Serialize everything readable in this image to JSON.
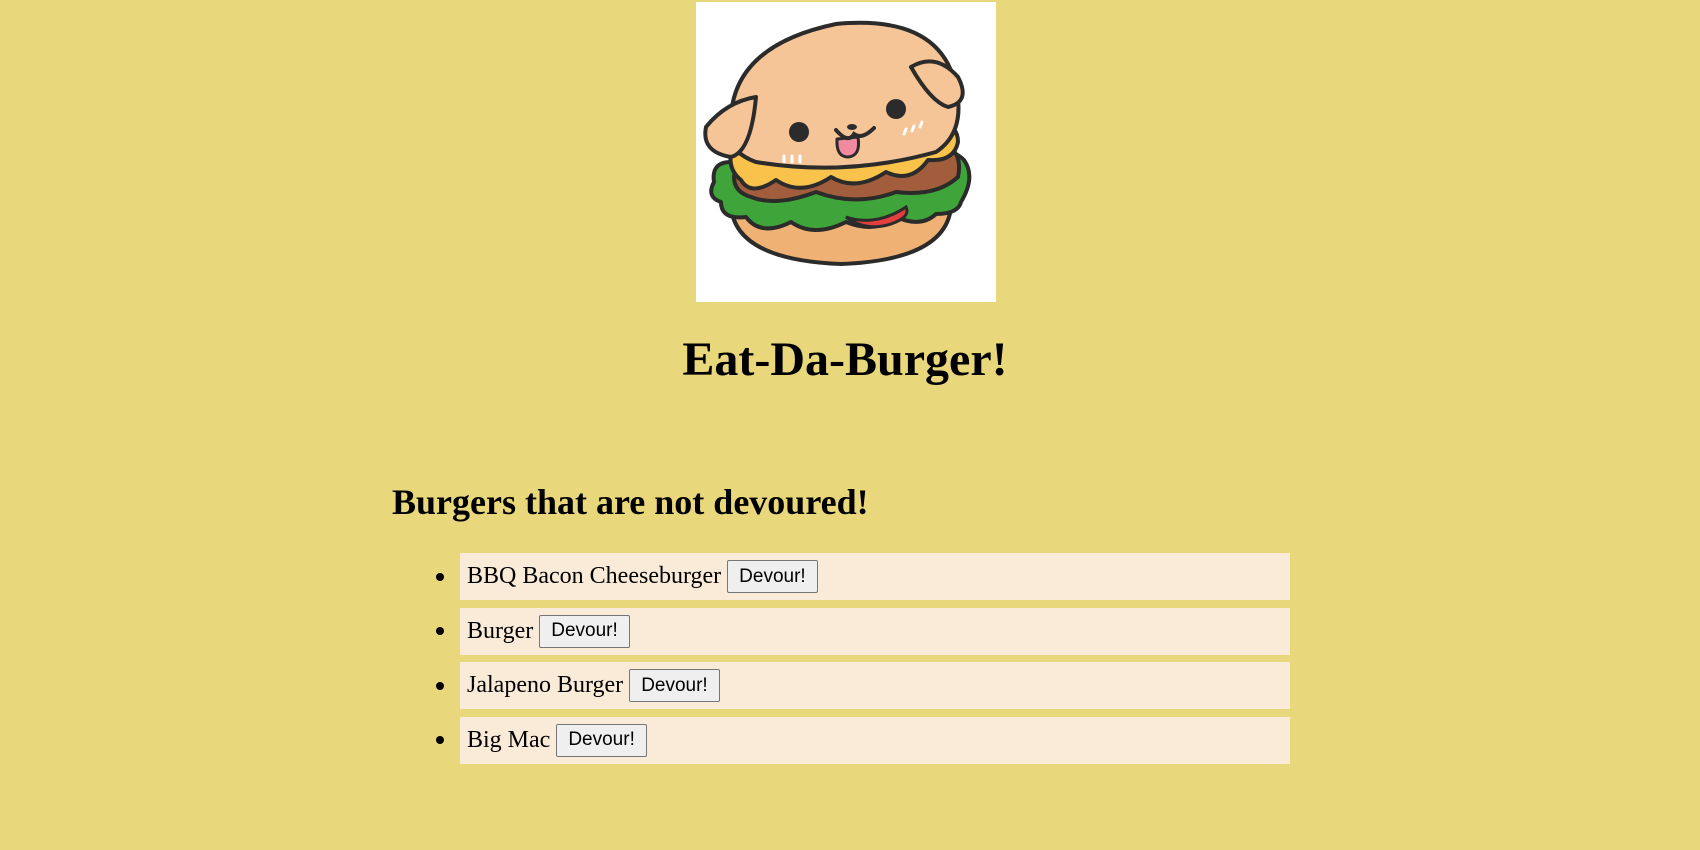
{
  "header": {
    "logo_icon": "burger-dog-icon",
    "title": "Eat-Da-Burger!"
  },
  "main": {
    "section_heading": "Burgers that are not devoured!",
    "burgers": [
      {
        "name": "BBQ Bacon Cheeseburger",
        "button_label": "Devour!"
      },
      {
        "name": "Burger",
        "button_label": "Devour!"
      },
      {
        "name": "Jalapeno Burger",
        "button_label": "Devour!"
      },
      {
        "name": "Big Mac",
        "button_label": "Devour!"
      }
    ]
  },
  "colors": {
    "page_background": "#e8d77b",
    "item_background": "#f9ebd7",
    "bun": "#f6c597",
    "cheese": "#f9c24a",
    "patty": "#a25e3c",
    "lettuce": "#3fa53a",
    "tomato": "#e2403f",
    "tongue": "#f08aa0"
  }
}
